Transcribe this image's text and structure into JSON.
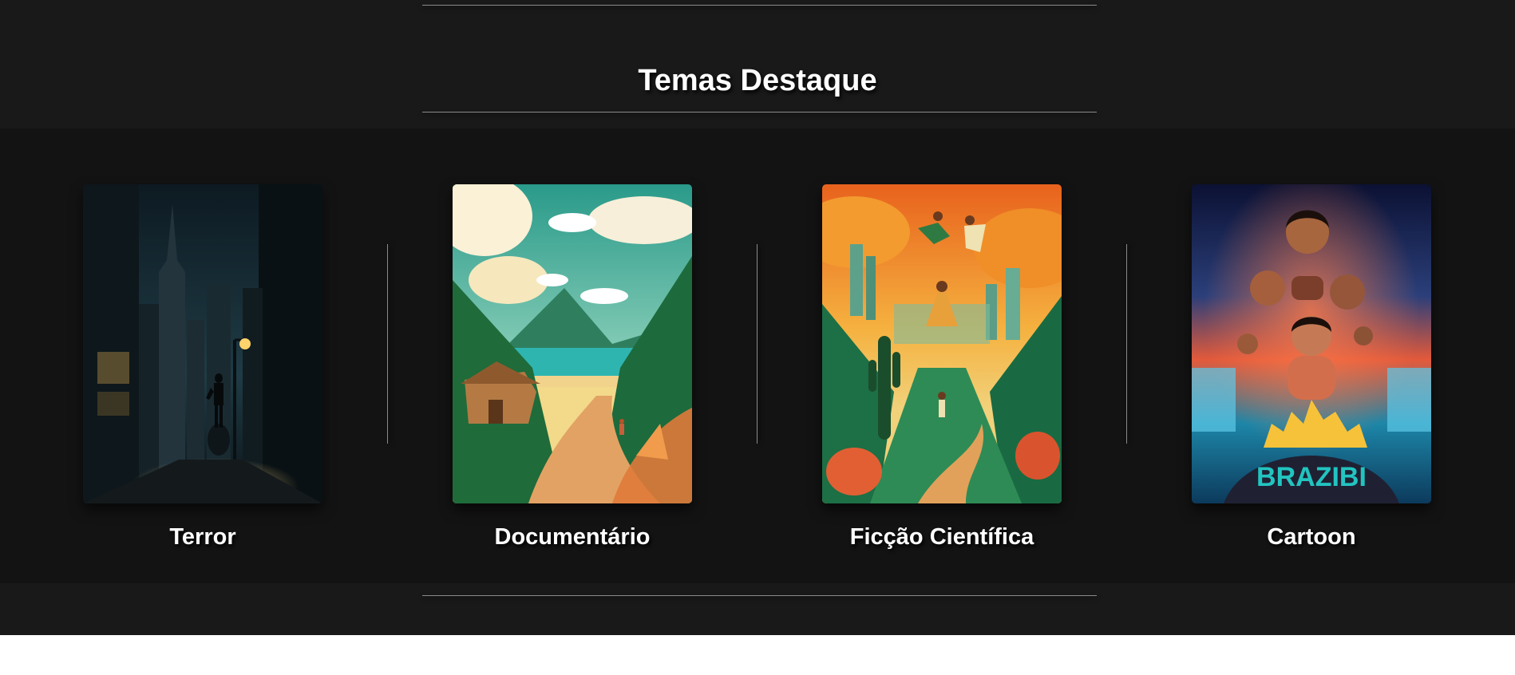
{
  "section": {
    "title": "Temas Destaque"
  },
  "themes": [
    {
      "label": "Terror",
      "image": "noir-city-saxophonist-illustration"
    },
    {
      "label": "Documentário",
      "image": "tropical-beach-path-hut-illustration"
    },
    {
      "label": "Ficção Científica",
      "image": "dancers-over-jungle-city-illustration"
    },
    {
      "label": "Cartoon",
      "image": "animated-family-poster-illustration",
      "poster_text": "BRAZIBI"
    }
  ],
  "colors": {
    "background": "#191919",
    "band": "#131313",
    "text": "#ffffff",
    "rule": "#8a8a8a"
  }
}
